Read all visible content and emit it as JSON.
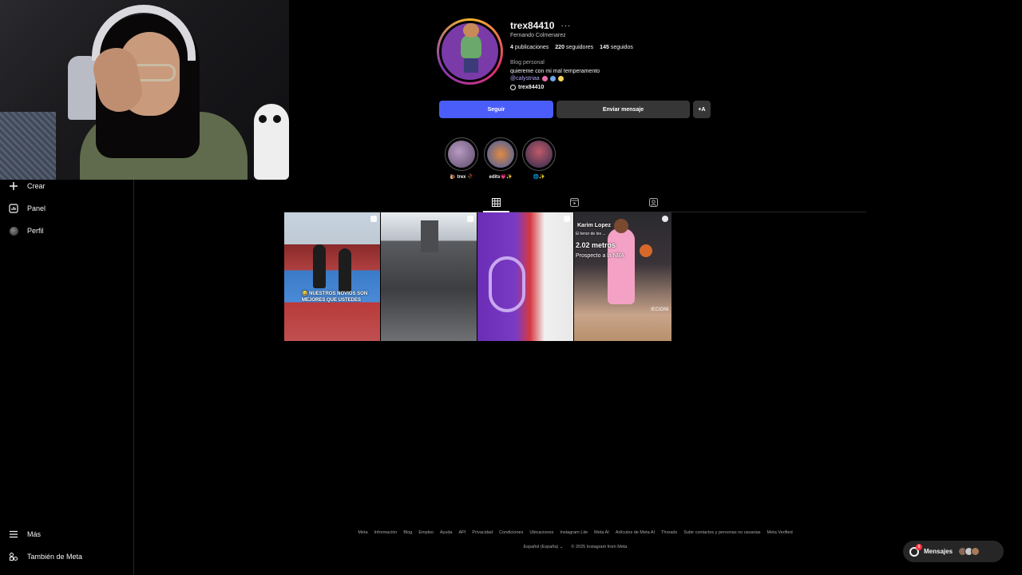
{
  "sidebar": {
    "crear": "Crear",
    "panel": "Panel",
    "perfil": "Perfil",
    "mas": "Más",
    "meta": "También de Meta"
  },
  "profile": {
    "username": "trex84410",
    "more": "···",
    "full_name": "Fernando Colmenarez",
    "stats": {
      "posts_num": "4",
      "posts_label": "publicaciones",
      "followers_num": "220",
      "followers_label": "seguidores",
      "following_num": "145",
      "following_label": "seguidos"
    },
    "category": "Blog personal",
    "bio": "quiereme con mi mal temperamento",
    "mention": "@calystriaa",
    "threads_handle": "trex84410"
  },
  "actions": {
    "follow": "Seguir",
    "message": "Enviar mensaje",
    "suggest": "+A"
  },
  "highlights": [
    {
      "label": "🐌 trex 🥀"
    },
    {
      "label": "edits💗✨"
    },
    {
      "label": "🌐✨"
    }
  ],
  "tabs": [
    "posts-grid",
    "reels",
    "tagged"
  ],
  "posts": [
    {
      "overlay_text": "😂 NUESTROS NOVIOS SON MEJORES QUE USTEDES"
    },
    {
      "overlay_text": ""
    },
    {
      "overlay_text": ""
    },
    {
      "name": "Karim Lopez",
      "line1": "El tenor de los ...",
      "height": "2.02 metros",
      "line3": "Prospecto a la NBA",
      "corner": "IECIONI"
    }
  ],
  "footer": {
    "links": [
      "Meta",
      "Información",
      "Blog",
      "Empleo",
      "Ayuda",
      "API",
      "Privacidad",
      "Condiciones",
      "Ubicaciones",
      "Instagram Lite",
      "Meta AI",
      "Artículos de Meta AI",
      "Threads",
      "Subir contactos y personas no usuarias",
      "Meta Verified"
    ],
    "language": "Español (España)",
    "copyright": "© 2025 Instagram from Meta"
  },
  "messages": {
    "label": "Mensajes",
    "count": "8"
  },
  "colors": {
    "background": "#000000",
    "follow_button": "#4a5df9",
    "secondary_button": "#363636",
    "mention": "#b6a8f8"
  }
}
